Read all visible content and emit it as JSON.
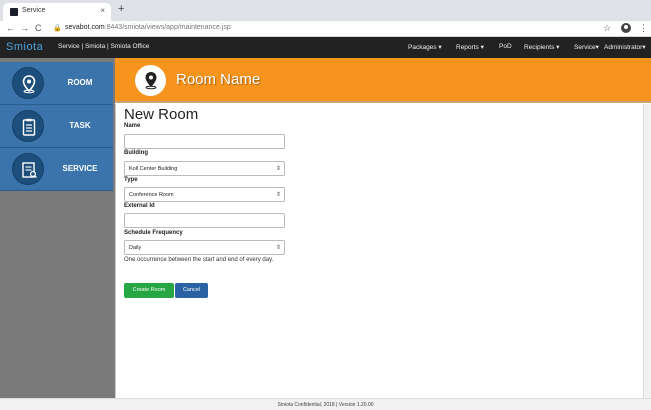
{
  "browser": {
    "tab_title": "Service",
    "tab_close": "×",
    "new_tab": "+",
    "url_host": "sevabot.com",
    "url_rest": ":8443/smiota/views/app/maintenance.jsp"
  },
  "navbar": {
    "brand": "Smiota",
    "subtitle": "Service | Smiota | Smiota Office",
    "menus": [
      "Packages ▾",
      "Reports ▾",
      "PoD",
      "Recipients ▾",
      "Service▾",
      "Administrator▾"
    ]
  },
  "sidebar": {
    "items": [
      {
        "label": "ROOM",
        "icon": "location-pin-icon"
      },
      {
        "label": "TASK",
        "icon": "clipboard-icon"
      },
      {
        "label": "SERVICE",
        "icon": "document-search-icon"
      }
    ]
  },
  "header": {
    "title": "Room Name",
    "icon": "location-pin-icon",
    "color": "#f7941d"
  },
  "form": {
    "title": "New Room",
    "name_label": "Name",
    "name_value": "",
    "building_label": "Building",
    "building_value": "Koll Center Building",
    "type_label": "Type",
    "type_value": "Conference Room",
    "external_id_label": "External Id",
    "external_id_value": "",
    "frequency_label": "Schedule Frequency",
    "frequency_value": "Daily",
    "frequency_help": "One occurrence between the start and end of every day.",
    "create_button": "Create Room",
    "cancel_button": "Cancel"
  },
  "footer": {
    "text": "Smiota Confidential, 2018 | Version 1.20.00"
  },
  "colors": {
    "brand": "#4aa3df",
    "sidebar_item": "#3a74ab",
    "create": "#27a744",
    "cancel": "#2a62a3"
  }
}
